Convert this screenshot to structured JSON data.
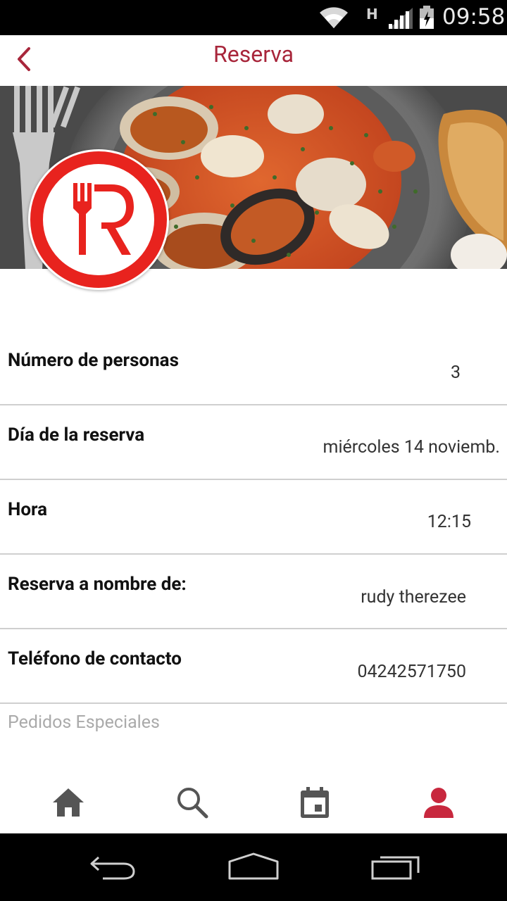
{
  "status_bar": {
    "network_type": "H",
    "time": "09:58",
    "icons": [
      "wifi-icon",
      "signal-icon",
      "battery-icon"
    ]
  },
  "app_bar": {
    "title": "Reserva",
    "back_icon": "chevron-left-icon"
  },
  "colors": {
    "accent": "#a8263b",
    "logo_red": "#e8231e",
    "nav_active": "#c8283e",
    "nav_inactive": "#555555"
  },
  "hero": {
    "logo_letter": "R"
  },
  "form": {
    "rows": [
      {
        "label": "Número de personas",
        "value": "3"
      },
      {
        "label": "Día de la reserva",
        "value": "miércoles 14 noviemb."
      },
      {
        "label": "Hora",
        "value": "12:15"
      },
      {
        "label": "Reserva a nombre de:",
        "value": "rudy therezee"
      },
      {
        "label": "Teléfono de contacto",
        "value": "04242571750"
      }
    ],
    "special_requests_placeholder": "Pedidos Especiales"
  },
  "bottom_nav": {
    "items": [
      {
        "icon": "home-icon",
        "active": false
      },
      {
        "icon": "search-icon",
        "active": false
      },
      {
        "icon": "calendar-icon",
        "active": false
      },
      {
        "icon": "profile-icon",
        "active": true
      }
    ]
  },
  "system_nav": {
    "items": [
      "back-icon",
      "home-outline-icon",
      "recents-icon"
    ]
  }
}
